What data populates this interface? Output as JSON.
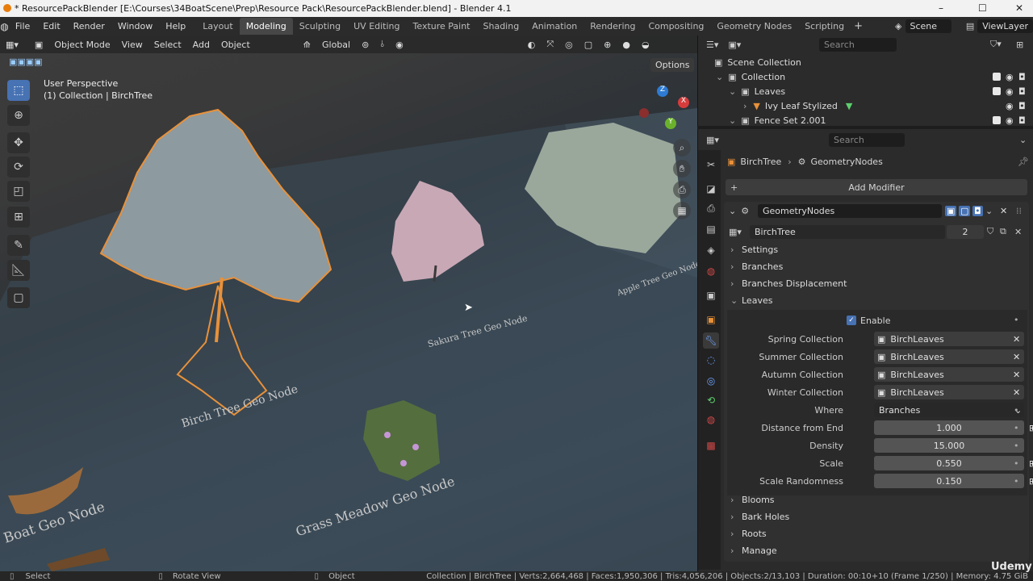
{
  "window": {
    "title": "* ResourcePackBlender [E:\\Courses\\34BoatScene\\Prep\\Resource Pack\\ResourcePackBlender.blend] - Blender 4.1",
    "minimize": "–",
    "maximize": "☐",
    "close": "✕"
  },
  "menu": [
    "File",
    "Edit",
    "Render",
    "Window",
    "Help"
  ],
  "workspaces": [
    "Layout",
    "Modeling",
    "Sculpting",
    "UV Editing",
    "Texture Paint",
    "Shading",
    "Animation",
    "Rendering",
    "Compositing",
    "Geometry Nodes",
    "Scripting"
  ],
  "active_workspace": "Modeling",
  "scene": {
    "name": "Scene",
    "view_layer": "ViewLayer"
  },
  "viewport": {
    "mode": "Object Mode",
    "menus": [
      "View",
      "Select",
      "Add",
      "Object"
    ],
    "transform": "Global",
    "options": "Options",
    "perspective": "User Perspective",
    "active": "(1) Collection | BirchTree",
    "labels": {
      "birch": "Birch Tree Geo Node",
      "sakura": "Sakura Tree Geo Node",
      "apple": "Apple Tree Geo Node",
      "grass": "Grass Meadow Geo Node",
      "boat": "Boat Geo Node"
    },
    "axes": {
      "x": "X",
      "y": "Y",
      "z": "Z"
    }
  },
  "outliner": {
    "search_placeholder": "Search",
    "root": "Scene Collection",
    "rows": [
      "Collection",
      "Leaves",
      "Ivy Leaf Stylized",
      "Fence Set 2.001"
    ]
  },
  "properties": {
    "search_placeholder": "Search",
    "breadcrumb": {
      "object": "BirchTree",
      "modifier": "GeometryNodes"
    },
    "add_modifier": "Add Modifier",
    "modifier_name": "GeometryNodes",
    "node_group": "BirchTree",
    "users": "2",
    "panels_top": [
      "Settings",
      "Branches",
      "Branches Displacement",
      "Leaves"
    ],
    "leaves": {
      "enable_label": "Enable",
      "enabled": true,
      "rows": [
        {
          "label": "Spring Collection",
          "value": "BirchLeaves",
          "kind": "collection"
        },
        {
          "label": "Summer Collection",
          "value": "BirchLeaves",
          "kind": "collection"
        },
        {
          "label": "Autumn Collection",
          "value": "BirchLeaves",
          "kind": "collection"
        },
        {
          "label": "Winter Collection",
          "value": "BirchLeaves",
          "kind": "collection"
        },
        {
          "label": "Where",
          "value": "Branches",
          "kind": "enum"
        },
        {
          "label": "Distance from End",
          "value": "1.000",
          "kind": "number"
        },
        {
          "label": "Density",
          "value": "15.000",
          "kind": "number"
        },
        {
          "label": "Scale",
          "value": "0.550",
          "kind": "number"
        },
        {
          "label": "Scale Randomness",
          "value": "0.150",
          "kind": "number"
        }
      ]
    },
    "panels_bottom": [
      "Blooms",
      "Bark Holes",
      "Roots",
      "Manage"
    ]
  },
  "statusbar": {
    "select": "Select",
    "rotate": "Rotate View",
    "object": "Object",
    "stats": "Collection | BirchTree | Verts:2,664,468 | Faces:1,950,306 | Tris:4,056,206 | Objects:2/13,103 | Duration: 00:10+10 (Frame 1/250) | Memory: 4.75 GiB"
  },
  "watermark": "Udemy",
  "colors": {
    "accent": "#4772b3",
    "selection": "#e8913a",
    "bg": "#2b2b2b"
  }
}
